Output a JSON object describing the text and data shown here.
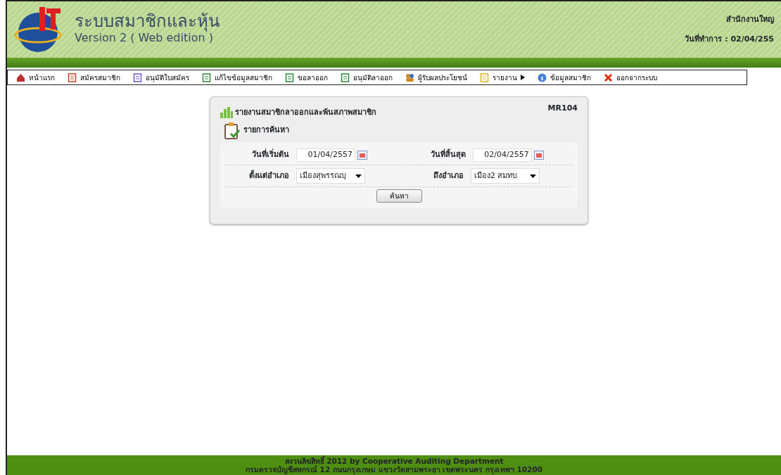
{
  "header": {
    "title": "ระบบสมาชิกและหุ้น",
    "subtitle": "Version 2 ( Web edition )",
    "office": "สำนักงานใหญ",
    "work_date": "วันที่ทำการ : 02/04/255"
  },
  "menu": [
    {
      "label": "หน้าแรก",
      "has_submenu": false
    },
    {
      "label": "สมัครสมาชิก",
      "has_submenu": false
    },
    {
      "label": "อนุมัติใบสมัคร",
      "has_submenu": false
    },
    {
      "label": "แก้ไขข้อมูลสมาชิก",
      "has_submenu": false
    },
    {
      "label": "ขอลาออก",
      "has_submenu": false
    },
    {
      "label": "อนุมัติลาออก",
      "has_submenu": false
    },
    {
      "label": "ผู้รับผลประโยชน์",
      "has_submenu": false
    },
    {
      "label": "รายงาน",
      "has_submenu": true
    },
    {
      "label": "ข้อมูลสมาชิก",
      "has_submenu": false
    },
    {
      "label": "ออกจากระบบ",
      "has_submenu": false
    }
  ],
  "panel": {
    "title": "รายงานสมาชิกลาออกและพ้นสภาพสมาชิก",
    "code": "MR104",
    "section": "รายการค้นหา",
    "rows": [
      {
        "fields": [
          {
            "kind": "date",
            "label": "วันที่เริ่มต้น",
            "value": "01/04/2557"
          },
          {
            "kind": "date",
            "label": "วันที่สิ้นสุด",
            "value": "02/04/2557"
          }
        ]
      },
      {
        "fields": [
          {
            "kind": "select",
            "label": "ตั้งแต่อำเภอ",
            "value": "เมืองสุพรรณบุ"
          },
          {
            "kind": "select",
            "label": "ถึงอำเภอ",
            "value": "เมือง2 สมทบ"
          }
        ]
      }
    ],
    "button": "ค้นหา"
  },
  "footer": [
    "สงวนลิขสิทธิ์ 2012 by Cooperative Auditing Department",
    "กรมตรวจบัญชีสหกรณ์ 12 ถนนกรุงเกษม แขวงวัดสามพระยา เขตพระนคร กรุงเทพฯ 10200"
  ]
}
